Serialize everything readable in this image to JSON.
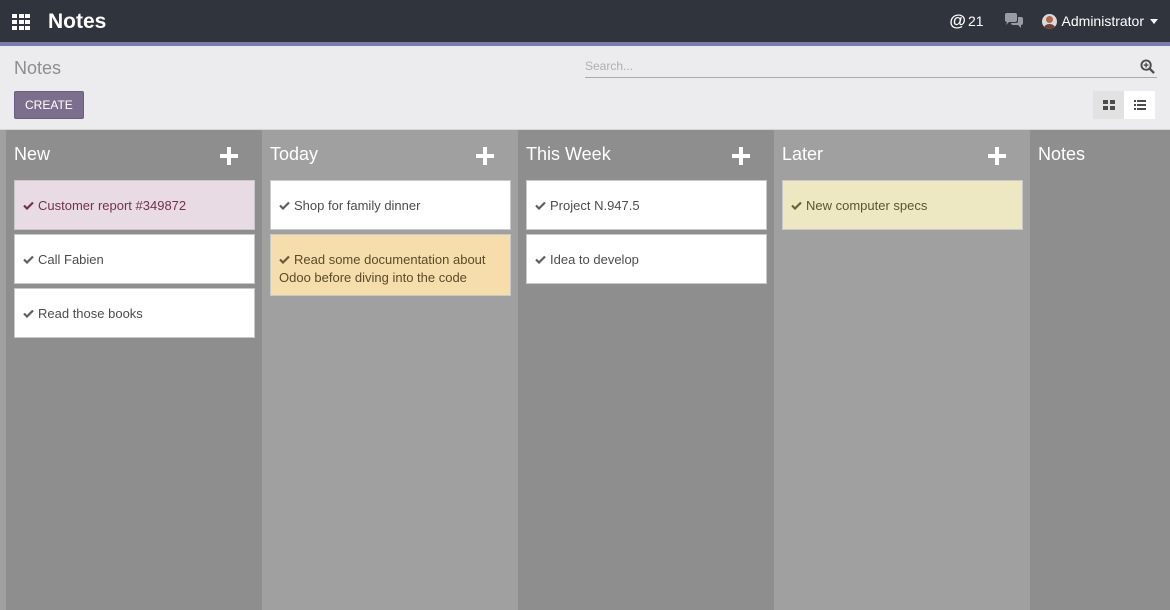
{
  "navbar": {
    "title": "Notes",
    "mention_count": "21",
    "user_name": "Administrator"
  },
  "control_panel": {
    "breadcrumb": "Notes",
    "search_placeholder": "Search...",
    "create_label": "CREATE"
  },
  "columns": [
    {
      "title": "New",
      "cards": [
        {
          "text": "Customer report #349872",
          "color": "#e9dbe4"
        },
        {
          "text": "Call Fabien",
          "color": "#ffffff"
        },
        {
          "text": "Read those books",
          "color": "#ffffff"
        }
      ]
    },
    {
      "title": "Today",
      "cards": [
        {
          "text": "Shop for family dinner",
          "color": "#ffffff"
        },
        {
          "text": "Read some documentation about Odoo before diving into the code",
          "color": "#f5deab"
        }
      ]
    },
    {
      "title": "This Week",
      "cards": [
        {
          "text": "Project N.947.5",
          "color": "#ffffff"
        },
        {
          "text": "Idea to develop",
          "color": "#ffffff"
        }
      ]
    },
    {
      "title": "Later",
      "cards": [
        {
          "text": "New computer specs",
          "color": "#ede8c2"
        }
      ]
    },
    {
      "title": "Notes",
      "cards": []
    }
  ]
}
